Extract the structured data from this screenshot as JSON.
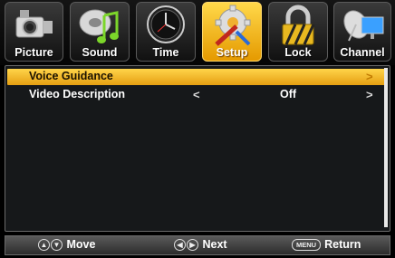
{
  "tabs": [
    {
      "label": "Picture",
      "icon": "camcorder-icon",
      "active": false
    },
    {
      "label": "Sound",
      "icon": "music-note-icon",
      "active": false
    },
    {
      "label": "Time",
      "icon": "clock-icon",
      "active": false
    },
    {
      "label": "Setup",
      "icon": "gear-tools-icon",
      "active": true
    },
    {
      "label": "Lock",
      "icon": "padlock-icon",
      "active": false
    },
    {
      "label": "Channel",
      "icon": "satellite-dish-icon",
      "active": false
    }
  ],
  "menu": {
    "items": [
      {
        "label": "Voice Guidance",
        "value": "",
        "selected": true
      },
      {
        "label": "Video Description",
        "value": "Off",
        "selected": false
      }
    ],
    "left_arrow": "<",
    "right_arrow": ">"
  },
  "help": {
    "move_label": "Move",
    "next_label": "Next",
    "menu_key": "MENU",
    "return_label": "Return"
  },
  "colors": {
    "accent": "#f2b526",
    "panel_bg": "#16181a",
    "help_bg": "#3c3c3c"
  }
}
